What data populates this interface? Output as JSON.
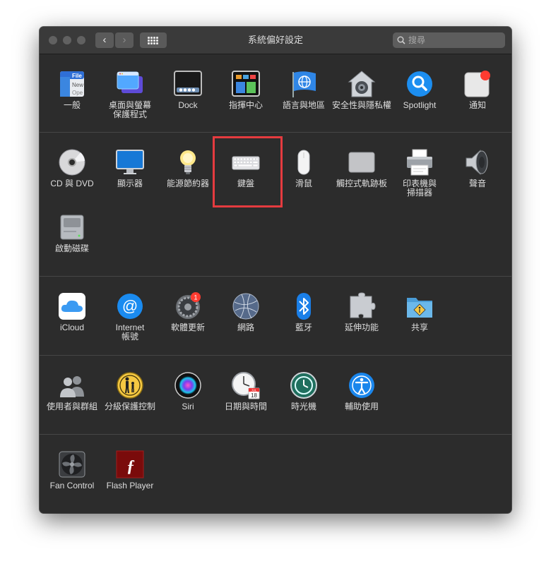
{
  "window": {
    "title": "系統偏好設定"
  },
  "toolbar": {
    "back": "‹",
    "forward": "›"
  },
  "search": {
    "placeholder": "搜尋"
  },
  "sections": [
    [
      {
        "key": "general",
        "label": "一般",
        "icon": "general-icon"
      },
      {
        "key": "desktop",
        "label": "桌面與螢幕\n保護程式",
        "icon": "desktop-screensaver-icon"
      },
      {
        "key": "dock",
        "label": "Dock",
        "icon": "dock-icon"
      },
      {
        "key": "mission",
        "label": "指揮中心",
        "icon": "mission-control-icon"
      },
      {
        "key": "language",
        "label": "語言與地區",
        "icon": "language-region-icon"
      },
      {
        "key": "security",
        "label": "安全性與隱私權",
        "icon": "security-privacy-icon"
      },
      {
        "key": "spotlight",
        "label": "Spotlight",
        "icon": "spotlight-icon"
      },
      {
        "key": "notifications",
        "label": "通知",
        "icon": "notifications-icon"
      }
    ],
    [
      {
        "key": "cddvd",
        "label": "CD 與 DVD",
        "icon": "cd-dvd-icon"
      },
      {
        "key": "displays",
        "label": "顯示器",
        "icon": "displays-icon"
      },
      {
        "key": "energy",
        "label": "能源節約器",
        "icon": "energy-saver-icon"
      },
      {
        "key": "keyboard",
        "label": "鍵盤",
        "icon": "keyboard-icon"
      },
      {
        "key": "mouse",
        "label": "滑鼠",
        "icon": "mouse-icon"
      },
      {
        "key": "trackpad",
        "label": "觸控式軌跡板",
        "icon": "trackpad-icon"
      },
      {
        "key": "printers",
        "label": "印表機與\n掃描器",
        "icon": "printers-scanners-icon"
      },
      {
        "key": "sound",
        "label": "聲音",
        "icon": "sound-icon"
      },
      {
        "key": "startup",
        "label": "啟動磁碟",
        "icon": "startup-disk-icon"
      }
    ],
    [
      {
        "key": "icloud",
        "label": "iCloud",
        "icon": "icloud-icon"
      },
      {
        "key": "internet",
        "label": "Internet\n帳號",
        "icon": "internet-accounts-icon"
      },
      {
        "key": "update",
        "label": "軟體更新",
        "icon": "software-update-icon",
        "badge": "1"
      },
      {
        "key": "network",
        "label": "網路",
        "icon": "network-icon"
      },
      {
        "key": "bluetooth",
        "label": "藍牙",
        "icon": "bluetooth-icon"
      },
      {
        "key": "extensions",
        "label": "延伸功能",
        "icon": "extensions-icon"
      },
      {
        "key": "sharing",
        "label": "共享",
        "icon": "sharing-icon"
      }
    ],
    [
      {
        "key": "users",
        "label": "使用者與群組",
        "icon": "users-groups-icon"
      },
      {
        "key": "parental",
        "label": "分級保護控制",
        "icon": "parental-controls-icon"
      },
      {
        "key": "siri",
        "label": "Siri",
        "icon": "siri-icon"
      },
      {
        "key": "datetime",
        "label": "日期與時間",
        "icon": "date-time-icon",
        "calendar_month": "JUL",
        "calendar_day": "18"
      },
      {
        "key": "timemachine",
        "label": "時光機",
        "icon": "time-machine-icon"
      },
      {
        "key": "accessibility",
        "label": "輔助使用",
        "icon": "accessibility-icon"
      }
    ],
    [
      {
        "key": "fancontrol",
        "label": "Fan Control",
        "icon": "fan-control-icon"
      },
      {
        "key": "flash",
        "label": "Flash Player",
        "icon": "flash-player-icon"
      }
    ]
  ],
  "general_icon_text": {
    "file": "File",
    "new": "New",
    "open": "Ope"
  },
  "colors": {
    "highlight": "#e53b3f",
    "window_bg": "#2c2c2c",
    "titlebar": "#3a3a3a",
    "label": "#dedede"
  }
}
